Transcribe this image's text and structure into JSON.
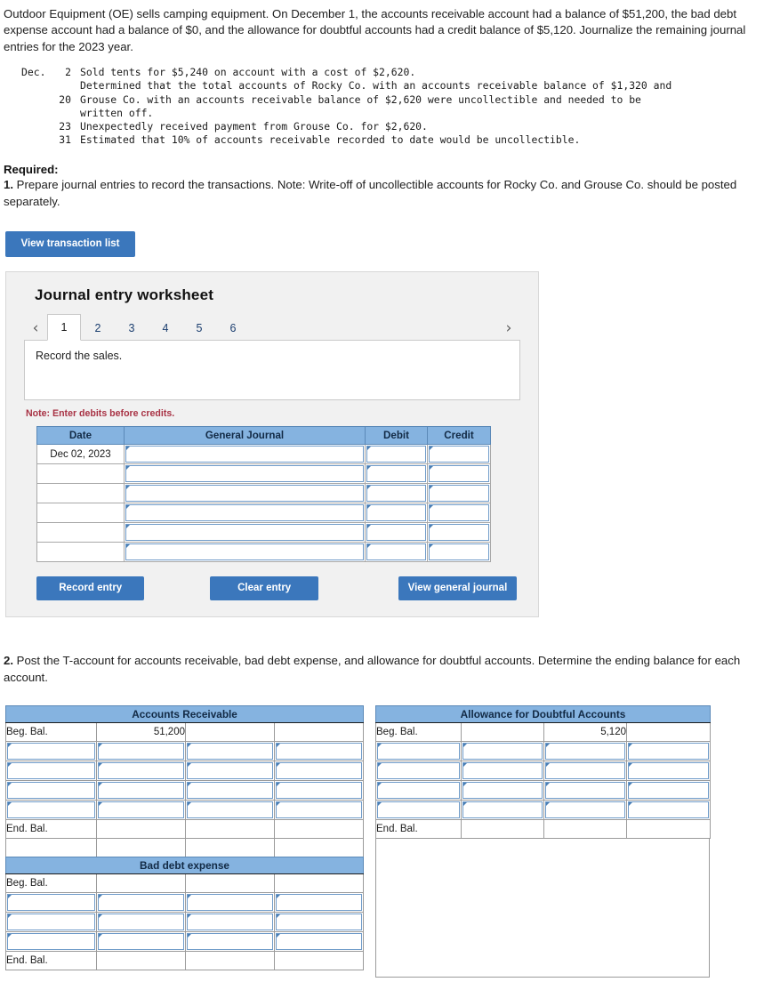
{
  "problem": {
    "paragraph": "Outdoor Equipment (OE) sells camping equipment. On December 1, the accounts receivable account had a balance of $51,200, the bad debt expense account had a balance of $0, and the allowance for doubtful accounts had a credit balance of $5,120. Journalize the remaining journal entries for the 2023 year.",
    "transactions": [
      {
        "month": "Dec.",
        "day": "2",
        "lines": [
          "Sold tents for $5,240 on account with a cost of $2,620.",
          "Determined that the total accounts of Rocky Co. with an accounts receivable balance of $1,320 and"
        ]
      },
      {
        "month": "",
        "day": "20",
        "lines": [
          "Grouse Co. with an accounts receivable balance of $2,620 were uncollectible and needed to be",
          "written off."
        ]
      },
      {
        "month": "",
        "day": "23",
        "lines": [
          "Unexpectedly received payment from Grouse Co. for $2,620."
        ]
      },
      {
        "month": "",
        "day": "31",
        "lines": [
          "Estimated that 10% of accounts receivable recorded to date would be uncollectible."
        ]
      }
    ]
  },
  "required": {
    "heading": "Required:",
    "item1_number": "1.",
    "item1_text": " Prepare journal entries to record the transactions. Note: Write-off of uncollectible accounts for Rocky Co. and Grouse Co. should be posted separately."
  },
  "buttons": {
    "view_transaction_list": "View transaction list",
    "record_entry": "Record entry",
    "clear_entry": "Clear entry",
    "view_general_journal": "View general journal"
  },
  "worksheet": {
    "title": "Journal entry worksheet",
    "prev_arrow": "‹",
    "next_arrow": "›",
    "tabs": [
      "1",
      "2",
      "3",
      "4",
      "5",
      "6"
    ],
    "active_tab": "1",
    "instruction": "Record the sales.",
    "note": "Note: Enter debits before credits.",
    "table": {
      "headers": [
        "Date",
        "General Journal",
        "Debit",
        "Credit"
      ],
      "rows": [
        {
          "date": "Dec 02, 2023",
          "general_journal": "",
          "debit": "",
          "credit": ""
        },
        {
          "date": "",
          "general_journal": "",
          "debit": "",
          "credit": ""
        },
        {
          "date": "",
          "general_journal": "",
          "debit": "",
          "credit": ""
        },
        {
          "date": "",
          "general_journal": "",
          "debit": "",
          "credit": ""
        },
        {
          "date": "",
          "general_journal": "",
          "debit": "",
          "credit": ""
        },
        {
          "date": "",
          "general_journal": "",
          "debit": "",
          "credit": ""
        }
      ]
    }
  },
  "part2": {
    "number": "2.",
    "text": " Post the T-account for accounts receivable, bad debt expense, and allowance for doubtful accounts. Determine the ending balance for each account."
  },
  "taccounts": {
    "accounts_receivable": {
      "title": "Accounts Receivable",
      "beg_label": "Beg. Bal.",
      "beg_debit": "51,200",
      "beg_credit": "",
      "entry_rows": 4,
      "end_label": "End. Bal.",
      "end_debit": "",
      "end_credit": ""
    },
    "bad_debt_expense": {
      "title": "Bad debt expense",
      "beg_label": "Beg. Bal.",
      "beg_debit": "",
      "beg_credit": "",
      "entry_rows": 3,
      "end_label": "End. Bal.",
      "end_debit": "",
      "end_credit": ""
    },
    "allowance_for_doubtful_accounts": {
      "title": "Allowance for Doubtful Accounts",
      "beg_label": "Beg. Bal.",
      "beg_debit": "",
      "beg_credit": "5,120",
      "entry_rows": 4,
      "end_label": "End. Bal.",
      "end_debit": "",
      "end_credit": ""
    }
  },
  "colors": {
    "header_blue": "#85b3e0",
    "button_blue": "#3b77bc",
    "note_red": "#a83244",
    "panel_gray": "#f1f1f1"
  }
}
